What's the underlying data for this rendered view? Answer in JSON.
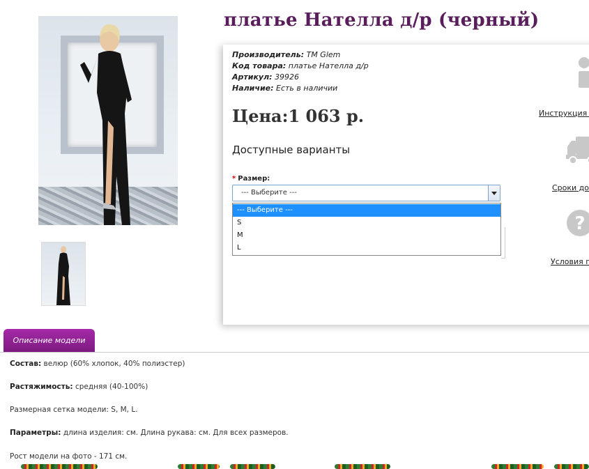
{
  "product": {
    "title": "платье Нателла д/р (черный)",
    "meta": [
      {
        "label": "Производитель:",
        "value": "TM Glem"
      },
      {
        "label": "Код товара:",
        "value": "платье Нателла д/р"
      },
      {
        "label": "Артикул:",
        "value": "39926"
      },
      {
        "label": "Наличие:",
        "value": "Есть в наличии"
      }
    ],
    "price": "Цена:1 063 р.",
    "variants_heading": "Доступные варианты",
    "size_label": "Размер:",
    "size_required_mark": "*",
    "size_selected": "--- Выберите ---",
    "size_options": [
      "--- Выберите ---",
      "S",
      "M",
      "L"
    ]
  },
  "sidebar": {
    "links": [
      {
        "label": "Инструкция п",
        "icon": "info-icon"
      },
      {
        "label": "Сроки дос",
        "icon": "truck-icon"
      },
      {
        "label": "Условия по",
        "icon": "question-icon"
      }
    ]
  },
  "tabs": {
    "description_label": "Описание модели"
  },
  "description": [
    {
      "label": "Состав:",
      "text": "велюр (60% хлопок, 40% полиэстер)"
    },
    {
      "label": "Растяжимость:",
      "text": "средняя (40-100%)"
    },
    {
      "label": "",
      "text": "Размерная сетка модели: S, M, L."
    },
    {
      "label": "Параметры:",
      "text": "длина изделия: см. Длина рукава: см. Для всех размеров."
    },
    {
      "label": "",
      "text": "Рост модели на фото - 171 см."
    }
  ],
  "colors": {
    "title": "#5a1d5c",
    "tab": "#8e2391",
    "option_selected": "#1e90ff",
    "icon_gray": "#c8c8c8"
  }
}
